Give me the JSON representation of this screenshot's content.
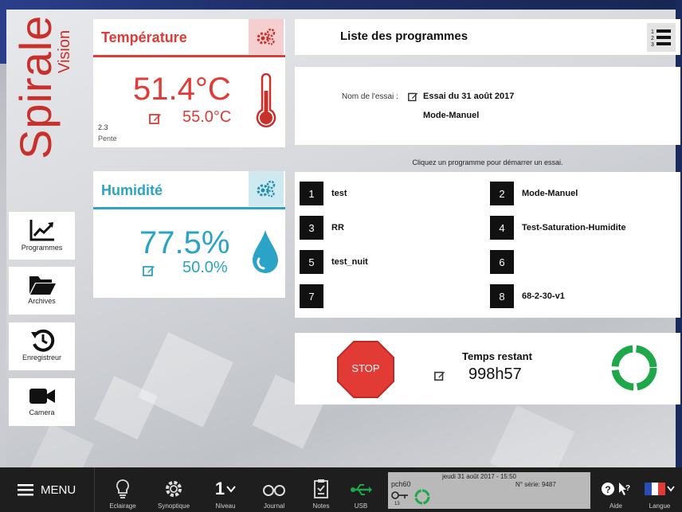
{
  "brand": {
    "name": "Spirale",
    "sub": "Vision"
  },
  "temperature": {
    "title": "Température",
    "current": "51.4°C",
    "setpoint": "55.0°C",
    "slope_value": "2.3",
    "slope_label": "Pente"
  },
  "humidity": {
    "title": "Humidité",
    "current": "77.5%",
    "setpoint": "50.0%"
  },
  "programs_header": {
    "title": "Liste des programmes"
  },
  "test": {
    "name_label": "Nom de l'essai :",
    "name_value": "Essai du 31 août 2017",
    "mode": "Mode-Manuel"
  },
  "hint": "Cliquez un programme pour démarrer un essai.",
  "programs": [
    {
      "num": "1",
      "name": "test"
    },
    {
      "num": "2",
      "name": "Mode-Manuel"
    },
    {
      "num": "3",
      "name": "RR"
    },
    {
      "num": "4",
      "name": "Test-Saturation-Humidite"
    },
    {
      "num": "5",
      "name": "test_nuit"
    },
    {
      "num": "6",
      "name": ""
    },
    {
      "num": "7",
      "name": ""
    },
    {
      "num": "8",
      "name": "68-2-30-v1"
    }
  ],
  "remaining": {
    "label": "Temps restant",
    "value": "998h57",
    "stop_label": "STOP"
  },
  "nav": [
    {
      "label": "Programmes",
      "icon": "chart-icon"
    },
    {
      "label": "Archives",
      "icon": "folder-icon"
    },
    {
      "label": "Enregistreur",
      "icon": "history-icon"
    },
    {
      "label": "Camera",
      "icon": "camera-icon"
    }
  ],
  "toolbar": {
    "menu": "MENU",
    "items": [
      {
        "label": "Eclairage",
        "icon": "bulb-icon"
      },
      {
        "label": "Synoptique",
        "icon": "gear-icon"
      },
      {
        "label": "Niveau",
        "icon": "level-icon",
        "glyph": "1"
      },
      {
        "label": "Journal",
        "icon": "glasses-icon"
      },
      {
        "label": "Notes",
        "icon": "notes-icon"
      },
      {
        "label": "USB",
        "icon": "usb-icon"
      }
    ],
    "status": {
      "datetime": "jeudi 31 août 2017 - 15:50",
      "host": "pch60",
      "serial": "N° série: 9487",
      "key_count": "13"
    },
    "help": "Aide",
    "lang": "Langue"
  },
  "colors": {
    "temperature": "#e23a34",
    "humidity": "#2aa3c7",
    "stop": "#e23a34",
    "ring": "#1fa84a"
  }
}
